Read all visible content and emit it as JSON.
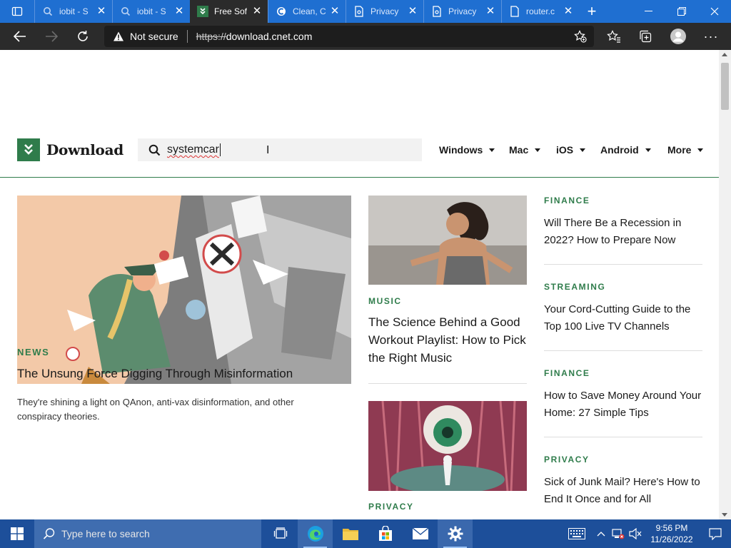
{
  "browser": {
    "tabs": [
      {
        "title": "iobit - S",
        "icon": "search-icon",
        "active": false
      },
      {
        "title": "iobit - S",
        "icon": "search-icon",
        "active": false
      },
      {
        "title": "Free Sof",
        "icon": "download-logo-icon",
        "active": true
      },
      {
        "title": "Clean, C",
        "icon": "ccleaner-icon",
        "active": false
      },
      {
        "title": "Privacy",
        "icon": "document-icon",
        "active": false
      },
      {
        "title": "Privacy",
        "icon": "document-icon",
        "active": false
      },
      {
        "title": "router.c",
        "icon": "document-icon",
        "active": false
      }
    ],
    "security_label": "Not secure",
    "url_scheme": "https://",
    "url_host": "download.cnet.com",
    "colors": {
      "tabbar": "#1f6fd1",
      "toolbar": "#2b2b2b"
    }
  },
  "site": {
    "logo_text": "Download",
    "search_value": "systemcar",
    "nav": [
      "Windows",
      "Mac",
      "iOS",
      "Android",
      "More"
    ],
    "brand_color": "#2f7c4b"
  },
  "hero": {
    "category": "NEWS",
    "title": "The Unsung Force Digging Through Misinformation",
    "description": "They're shining a light on QAnon, anti-vax disinformation, and other conspiracy theories."
  },
  "middle": [
    {
      "category": "MUSIC",
      "title": "The Science Behind a Good Workout Playlist: How to Pick the Right Music"
    },
    {
      "category": "PRIVACY",
      "title": ""
    }
  ],
  "right": [
    {
      "category": "FINANCE",
      "title": "Will There Be a Recession in 2022? How to Prepare Now"
    },
    {
      "category": "STREAMING",
      "title": "Your Cord-Cutting Guide to the Top 100 Live TV Channels"
    },
    {
      "category": "FINANCE",
      "title": "How to Save Money Around Your Home: 27 Simple Tips"
    },
    {
      "category": "PRIVACY",
      "title": "Sick of Junk Mail? Here's How to End It Once and for All"
    }
  ],
  "taskbar": {
    "search_placeholder": "Type here to search",
    "time": "9:56 PM",
    "date": "11/26/2022"
  }
}
